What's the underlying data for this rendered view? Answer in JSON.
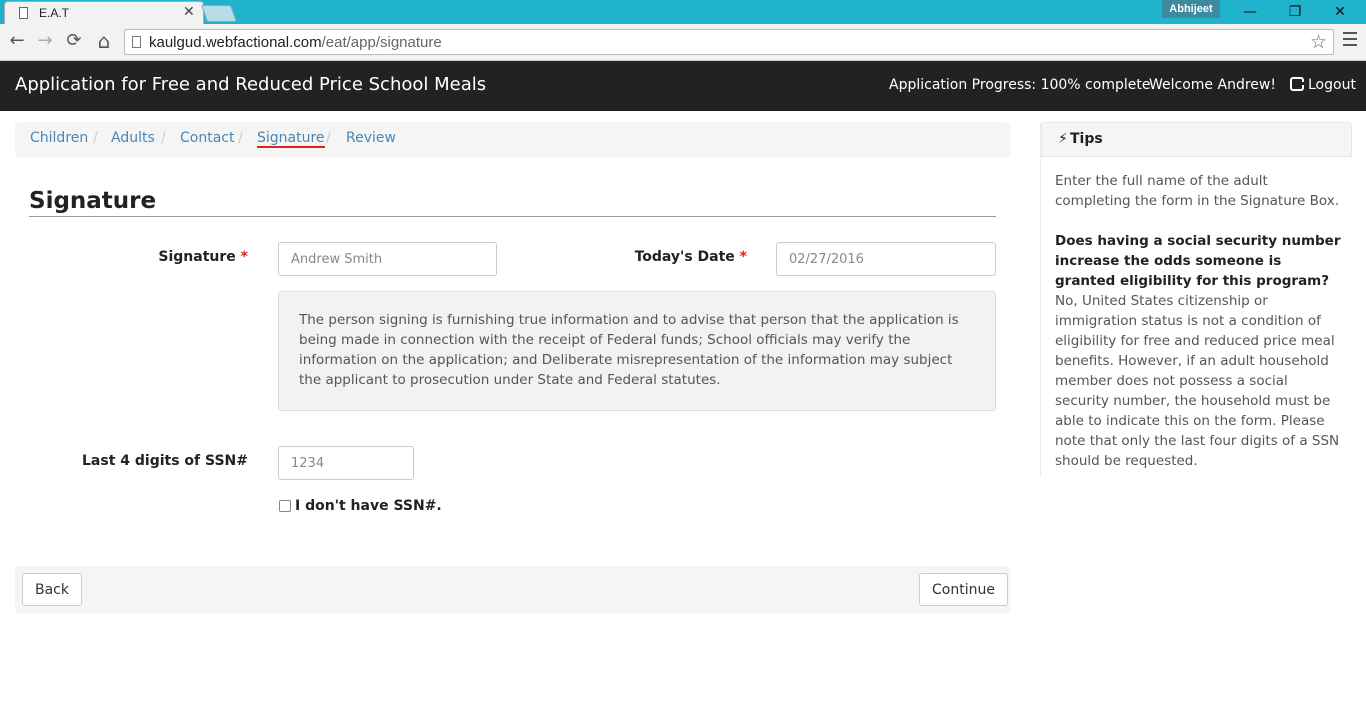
{
  "browser": {
    "tab_title": "E.A.T",
    "tab_close": "✕",
    "user": "Abhijeet",
    "window_minimize": "—",
    "window_restore": "❐",
    "window_close": "✕",
    "url_host": "kaulgud.webfactional.com",
    "url_path": "/eat/app/signature",
    "back_glyph": "←",
    "forward_glyph": "→",
    "reload_glyph": "⟳",
    "home_glyph": "⌂",
    "star_glyph": "☆"
  },
  "header": {
    "title": "Application for Free and Reduced Price School Meals",
    "progress": "Application Progress: 100% complete",
    "welcome": "Welcome Andrew!",
    "logout": "Logout"
  },
  "breadcrumb": {
    "items": [
      {
        "label": "Children"
      },
      {
        "label": "Adults"
      },
      {
        "label": "Contact"
      },
      {
        "label": "Signature",
        "active": true
      },
      {
        "label": "Review"
      }
    ],
    "separator": "/"
  },
  "form": {
    "section_title": "Signature",
    "required_mark": "*",
    "signature_label": "Signature",
    "signature_placeholder": "Andrew Smith",
    "date_label": "Today's Date",
    "date_placeholder": "02/27/2016",
    "notice": "The person signing is furnishing true information and to advise that person that the application is being made in connection with the receipt of Federal funds; School officials may verify the information on the application; and Deliberate misrepresentation of the information may subject the applicant to prosecution under State and Federal statutes.",
    "ssn_label": "Last 4 digits of SSN#",
    "ssn_placeholder": "1234",
    "no_ssn_label": "I don't have SSN#.",
    "no_ssn_checked": false
  },
  "actions": {
    "back_label": "Back",
    "continue_label": "Continue"
  },
  "tips": {
    "bolt_glyph": "⚡",
    "title": "Tips",
    "intro": "Enter the full name of the adult completing the form in the Signature Box.",
    "question": "Does having a social security number increase the odds someone is granted eligibility for this program?",
    "answer": "No, United States citizenship or immigration status is not a condition of eligibility for free and reduced price meal benefits. However, if an adult household member does not possess a social security number, the household must be able to indicate this on the form. Please note that only the last four digits of a SSN should be requested."
  },
  "colors": {
    "tabbar": "#1fb3cc",
    "header_bg": "#222222",
    "link": "#4a86b4",
    "required": "#d9230f",
    "active_underline": "#e2231a"
  }
}
